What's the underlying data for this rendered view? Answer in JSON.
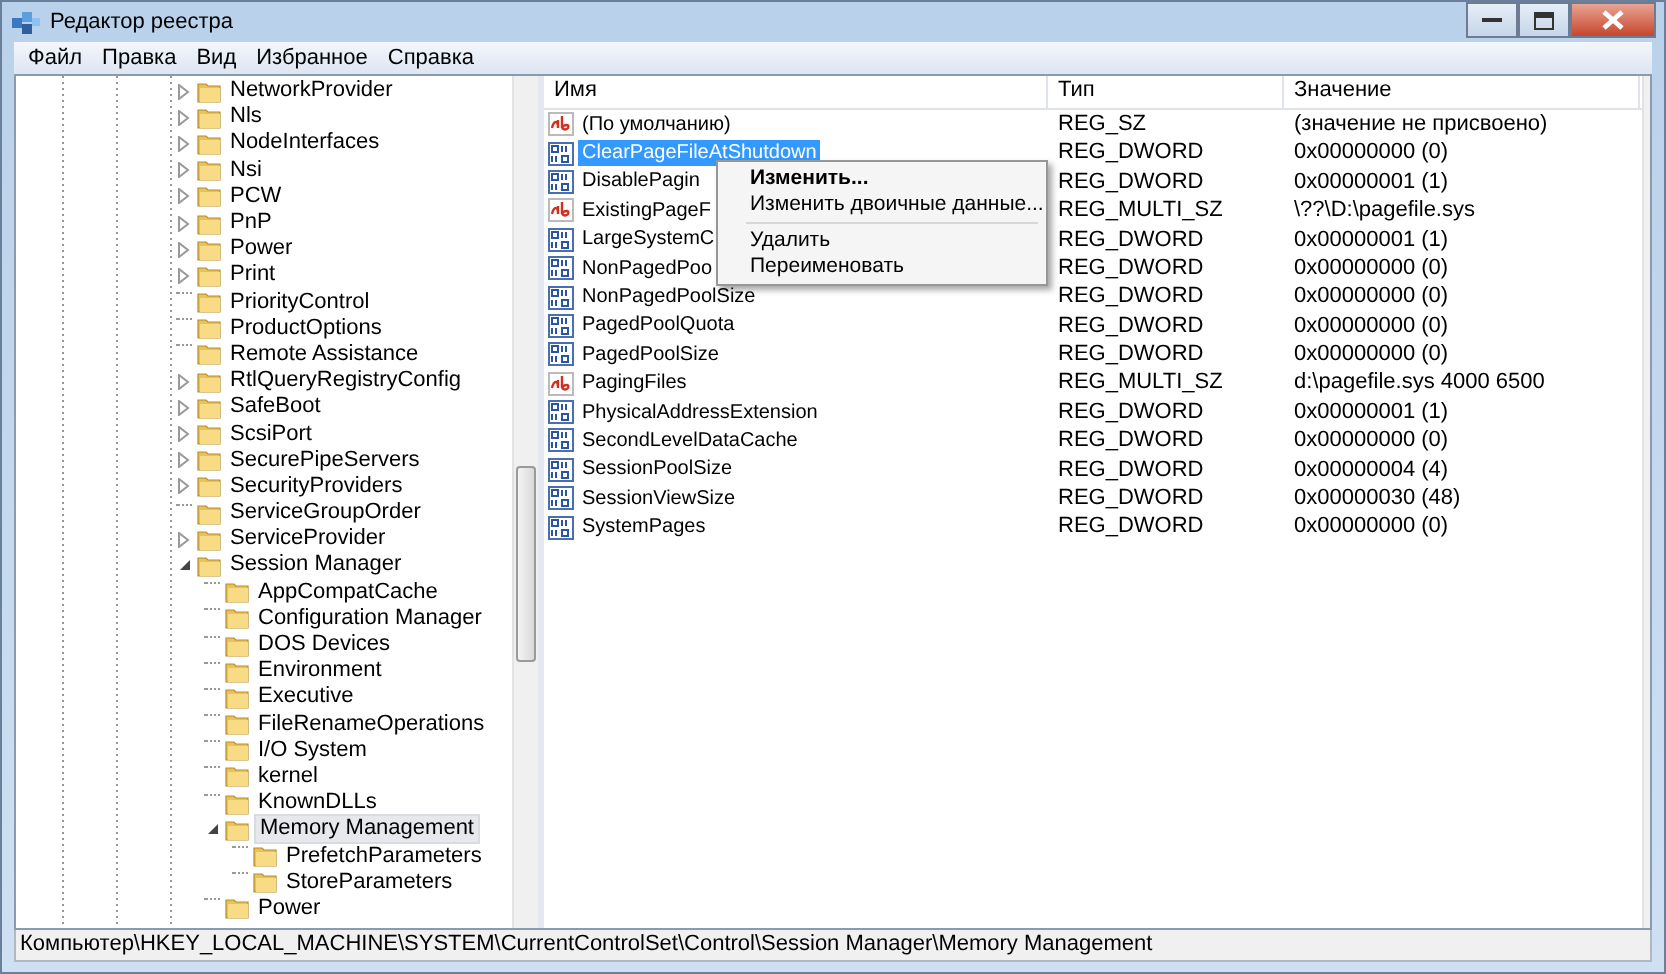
{
  "window": {
    "title": "Редактор реестра"
  },
  "menu": [
    "Файл",
    "Правка",
    "Вид",
    "Избранное",
    "Справка"
  ],
  "tree": [
    {
      "label": "NetworkProvider",
      "expandable": true,
      "expanded": false,
      "selected": false
    },
    {
      "label": "Nls",
      "expandable": true,
      "expanded": false,
      "selected": false
    },
    {
      "label": "NodeInterfaces",
      "expandable": true,
      "expanded": false,
      "selected": false
    },
    {
      "label": "Nsi",
      "expandable": true,
      "expanded": false,
      "selected": false
    },
    {
      "label": "PCW",
      "expandable": true,
      "expanded": false,
      "selected": false
    },
    {
      "label": "PnP",
      "expandable": true,
      "expanded": false,
      "selected": false
    },
    {
      "label": "Power",
      "expandable": true,
      "expanded": false,
      "selected": false
    },
    {
      "label": "Print",
      "expandable": true,
      "expanded": false,
      "selected": false
    },
    {
      "label": "PriorityControl",
      "expandable": false,
      "expanded": false,
      "selected": false
    },
    {
      "label": "ProductOptions",
      "expandable": false,
      "expanded": false,
      "selected": false
    },
    {
      "label": "Remote Assistance",
      "expandable": false,
      "expanded": false,
      "selected": false
    },
    {
      "label": "RtlQueryRegistryConfig",
      "expandable": true,
      "expanded": false,
      "selected": false
    },
    {
      "label": "SafeBoot",
      "expandable": true,
      "expanded": false,
      "selected": false
    },
    {
      "label": "ScsiPort",
      "expandable": true,
      "expanded": false,
      "selected": false
    },
    {
      "label": "SecurePipeServers",
      "expandable": true,
      "expanded": false,
      "selected": false
    },
    {
      "label": "SecurityProviders",
      "expandable": true,
      "expanded": false,
      "selected": false
    },
    {
      "label": "ServiceGroupOrder",
      "expandable": false,
      "expanded": false,
      "selected": false
    },
    {
      "label": "ServiceProvider",
      "expandable": true,
      "expanded": false,
      "selected": false
    },
    {
      "label": "Session Manager",
      "expandable": true,
      "expanded": true,
      "selected": false,
      "children": [
        {
          "label": "AppCompatCache",
          "expandable": false,
          "expanded": false,
          "selected": false
        },
        {
          "label": "Configuration Manager",
          "expandable": false,
          "expanded": false,
          "selected": false
        },
        {
          "label": "DOS Devices",
          "expandable": false,
          "expanded": false,
          "selected": false
        },
        {
          "label": "Environment",
          "expandable": false,
          "expanded": false,
          "selected": false
        },
        {
          "label": "Executive",
          "expandable": false,
          "expanded": false,
          "selected": false
        },
        {
          "label": "FileRenameOperations",
          "expandable": false,
          "expanded": false,
          "selected": false
        },
        {
          "label": "I/O System",
          "expandable": false,
          "expanded": false,
          "selected": false
        },
        {
          "label": "kernel",
          "expandable": false,
          "expanded": false,
          "selected": false
        },
        {
          "label": "KnownDLLs",
          "expandable": false,
          "expanded": false,
          "selected": false
        },
        {
          "label": "Memory Management",
          "expandable": true,
          "expanded": true,
          "selected": true,
          "children": [
            {
              "label": "PrefetchParameters",
              "expandable": false,
              "expanded": false,
              "selected": false
            },
            {
              "label": "StoreParameters",
              "expandable": false,
              "expanded": false,
              "selected": false
            }
          ]
        },
        {
          "label": "Power",
          "expandable": false,
          "expanded": false,
          "selected": false
        }
      ]
    }
  ],
  "list": {
    "columns": [
      "Имя",
      "Тип",
      "Значение"
    ],
    "rows": [
      {
        "kind": "string",
        "name": "(По умолчанию)",
        "type": "REG_SZ",
        "value": "(значение не присвоено)",
        "selected": false
      },
      {
        "kind": "dword",
        "name": "ClearPageFileAtShutdown",
        "type": "REG_DWORD",
        "value": "0x00000000 (0)",
        "selected": true
      },
      {
        "kind": "dword",
        "name": "DisablePagin",
        "type": "REG_DWORD",
        "value": "0x00000001 (1)",
        "selected": false
      },
      {
        "kind": "string",
        "name": "ExistingPageF",
        "type": "REG_MULTI_SZ",
        "value": "\\??\\D:\\pagefile.sys",
        "selected": false
      },
      {
        "kind": "dword",
        "name": "LargeSystemC",
        "type": "REG_DWORD",
        "value": "0x00000001 (1)",
        "selected": false
      },
      {
        "kind": "dword",
        "name": "NonPagedPoo",
        "type": "REG_DWORD",
        "value": "0x00000000 (0)",
        "selected": false
      },
      {
        "kind": "dword",
        "name": "NonPagedPoolSize",
        "type": "REG_DWORD",
        "value": "0x00000000 (0)",
        "selected": false
      },
      {
        "kind": "dword",
        "name": "PagedPoolQuota",
        "type": "REG_DWORD",
        "value": "0x00000000 (0)",
        "selected": false
      },
      {
        "kind": "dword",
        "name": "PagedPoolSize",
        "type": "REG_DWORD",
        "value": "0x00000000 (0)",
        "selected": false
      },
      {
        "kind": "string",
        "name": "PagingFiles",
        "type": "REG_MULTI_SZ",
        "value": "d:\\pagefile.sys 4000 6500",
        "selected": false
      },
      {
        "kind": "dword",
        "name": "PhysicalAddressExtension",
        "type": "REG_DWORD",
        "value": "0x00000001 (1)",
        "selected": false
      },
      {
        "kind": "dword",
        "name": "SecondLevelDataCache",
        "type": "REG_DWORD",
        "value": "0x00000000 (0)",
        "selected": false
      },
      {
        "kind": "dword",
        "name": "SessionPoolSize",
        "type": "REG_DWORD",
        "value": "0x00000004 (4)",
        "selected": false
      },
      {
        "kind": "dword",
        "name": "SessionViewSize",
        "type": "REG_DWORD",
        "value": "0x00000030 (48)",
        "selected": false
      },
      {
        "kind": "dword",
        "name": "SystemPages",
        "type": "REG_DWORD",
        "value": "0x00000000 (0)",
        "selected": false
      }
    ]
  },
  "context_menu": [
    {
      "kind": "item",
      "label": "Изменить...",
      "default": true
    },
    {
      "kind": "item",
      "label": "Изменить двоичные данные...",
      "default": false
    },
    {
      "kind": "separator"
    },
    {
      "kind": "item",
      "label": "Удалить",
      "default": false
    },
    {
      "kind": "item",
      "label": "Переименовать",
      "default": false
    }
  ],
  "status_bar": "Компьютер\\HKEY_LOCAL_MACHINE\\SYSTEM\\CurrentControlSet\\Control\\Session Manager\\Memory Management"
}
